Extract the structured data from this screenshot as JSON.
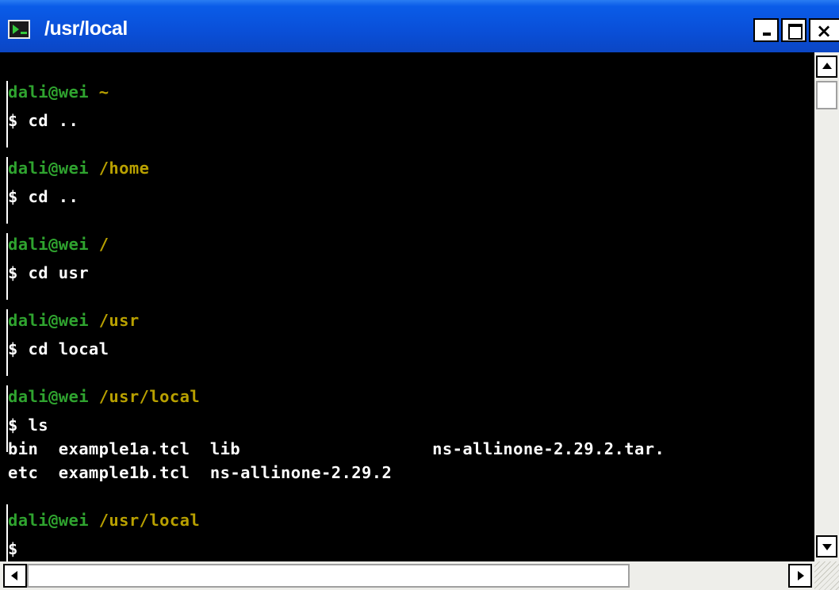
{
  "window": {
    "title": "/usr/local",
    "controls": {
      "minimize": "_",
      "maximize": "□",
      "close": "×"
    }
  },
  "colors": {
    "user": "#2fa32f",
    "path": "#b8a000",
    "text": "#ffffff",
    "background": "#000000",
    "titlebar": "#0a5ce8"
  },
  "terminal": {
    "lines": [
      {
        "user": "dali@wei",
        "path": "~"
      },
      {
        "text": "$ cd .."
      },
      {
        "user": "dali@wei",
        "path": "/home"
      },
      {
        "text": "$ cd .."
      },
      {
        "user": "dali@wei",
        "path": "/"
      },
      {
        "text": "$ cd usr"
      },
      {
        "user": "dali@wei",
        "path": "/usr"
      },
      {
        "text": "$ cd local"
      },
      {
        "user": "dali@wei",
        "path": "/usr/local"
      },
      {
        "text": "$ ls"
      },
      {
        "text": "bin  example1a.tcl  lib                   ns-allinone-2.29.2.tar."
      },
      {
        "text": "etc  example1b.tcl  ns-allinone-2.29.2"
      },
      {
        "user": "dali@wei",
        "path": "/usr/local"
      },
      {
        "text": "$"
      }
    ]
  },
  "icons": {
    "app": "terminal-icon",
    "scroll_up": "arrow-up-icon",
    "scroll_down": "arrow-down-icon",
    "scroll_left": "arrow-left-icon",
    "scroll_right": "arrow-right-icon"
  }
}
